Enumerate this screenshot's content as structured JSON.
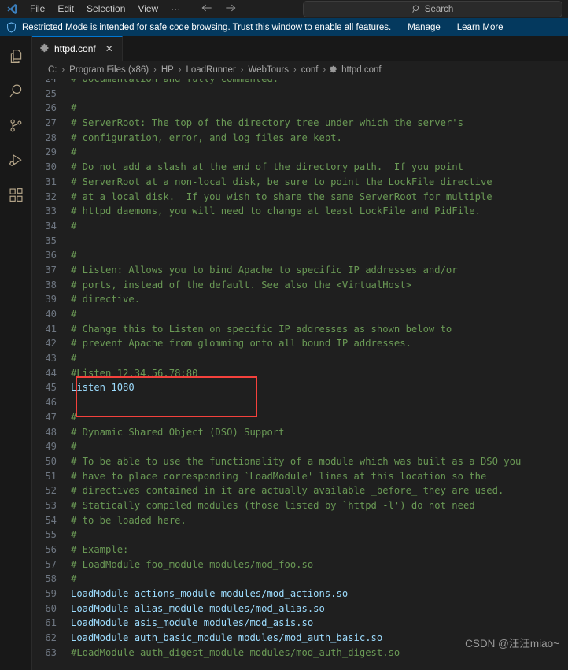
{
  "titlebar": {
    "logo_icon": "vscode-logo-icon",
    "menus": [
      {
        "label": "File"
      },
      {
        "label": "Edit"
      },
      {
        "label": "Selection"
      },
      {
        "label": "View"
      },
      {
        "label": "···"
      }
    ],
    "back_icon": "arrow-left-icon",
    "forward_icon": "arrow-right-icon",
    "search": {
      "icon": "search-icon",
      "placeholder": "Search",
      "value": "Search"
    }
  },
  "banner": {
    "icon": "shield-icon",
    "text": "Restricted Mode is intended for safe code browsing. Trust this window to enable all features.",
    "manage_label": "Manage",
    "learn_more_label": "Learn More",
    "background": "#04395e"
  },
  "activitybar": {
    "items": [
      {
        "name": "explorer",
        "icon": "files-icon",
        "active": true
      },
      {
        "name": "search",
        "icon": "search-icon",
        "active": false
      },
      {
        "name": "source-control",
        "icon": "source-control-icon",
        "active": false
      },
      {
        "name": "run-and-debug",
        "icon": "run-debug-icon",
        "active": false
      },
      {
        "name": "extensions",
        "icon": "extensions-icon",
        "active": false
      }
    ]
  },
  "tabs": [
    {
      "icon": "gear-icon",
      "label": "httpd.conf",
      "close_icon": "close-icon",
      "active": true
    }
  ],
  "breadcrumbs": {
    "separator": "›",
    "file_icon": "gear-icon",
    "items": [
      "C:",
      "Program Files (x86)",
      "HP",
      "LoadRunner",
      "WebTours",
      "conf",
      "httpd.conf"
    ]
  },
  "annotation": {
    "box_color": "#f4413c",
    "highlighted_lines": [
      "44",
      "45"
    ]
  },
  "watermark": {
    "text": "CSDN @汪汪miao~"
  },
  "editor": {
    "language": "apacheconf",
    "first_visible_line": 24,
    "colors": {
      "comment": "#6a9955",
      "directive": "#9cdcfe",
      "background": "#1f1f1f",
      "line_number": "#6e7681"
    },
    "lines": [
      {
        "num": "24",
        "text": "# documentation and fully commented.",
        "kind": "comment",
        "clipped": true
      },
      {
        "num": "25",
        "text": "",
        "kind": "plain"
      },
      {
        "num": "26",
        "text": "#",
        "kind": "comment"
      },
      {
        "num": "27",
        "text": "# ServerRoot: The top of the directory tree under which the server's",
        "kind": "comment"
      },
      {
        "num": "28",
        "text": "# configuration, error, and log files are kept.",
        "kind": "comment"
      },
      {
        "num": "29",
        "text": "#",
        "kind": "comment"
      },
      {
        "num": "30",
        "text": "# Do not add a slash at the end of the directory path.  If you point",
        "kind": "comment"
      },
      {
        "num": "31",
        "text": "# ServerRoot at a non-local disk, be sure to point the LockFile directive",
        "kind": "comment"
      },
      {
        "num": "32",
        "text": "# at a local disk.  If you wish to share the same ServerRoot for multiple",
        "kind": "comment"
      },
      {
        "num": "33",
        "text": "# httpd daemons, you will need to change at least LockFile and PidFile.",
        "kind": "comment"
      },
      {
        "num": "34",
        "text": "#",
        "kind": "comment"
      },
      {
        "num": "35",
        "text": "",
        "kind": "plain"
      },
      {
        "num": "36",
        "text": "#",
        "kind": "comment"
      },
      {
        "num": "37",
        "text": "# Listen: Allows you to bind Apache to specific IP addresses and/or",
        "kind": "comment"
      },
      {
        "num": "38",
        "text": "# ports, instead of the default. See also the <VirtualHost>",
        "kind": "comment"
      },
      {
        "num": "39",
        "text": "# directive.",
        "kind": "comment"
      },
      {
        "num": "40",
        "text": "#",
        "kind": "comment"
      },
      {
        "num": "41",
        "text": "# Change this to Listen on specific IP addresses as shown below to",
        "kind": "comment"
      },
      {
        "num": "42",
        "text": "# prevent Apache from glomming onto all bound IP addresses.",
        "kind": "comment"
      },
      {
        "num": "43",
        "text": "#",
        "kind": "comment"
      },
      {
        "num": "44",
        "text": "#Listen 12.34.56.78:80",
        "kind": "comment"
      },
      {
        "num": "45",
        "text": "Listen 1080",
        "kind": "code"
      },
      {
        "num": "46",
        "text": "",
        "kind": "plain"
      },
      {
        "num": "47",
        "text": "#",
        "kind": "comment"
      },
      {
        "num": "48",
        "text": "# Dynamic Shared Object (DSO) Support",
        "kind": "comment"
      },
      {
        "num": "49",
        "text": "#",
        "kind": "comment"
      },
      {
        "num": "50",
        "text": "# To be able to use the functionality of a module which was built as a DSO you",
        "kind": "comment"
      },
      {
        "num": "51",
        "text": "# have to place corresponding `LoadModule' lines at this location so the",
        "kind": "comment"
      },
      {
        "num": "52",
        "text": "# directives contained in it are actually available _before_ they are used.",
        "kind": "comment"
      },
      {
        "num": "53",
        "text": "# Statically compiled modules (those listed by `httpd -l') do not need",
        "kind": "comment"
      },
      {
        "num": "54",
        "text": "# to be loaded here.",
        "kind": "comment"
      },
      {
        "num": "55",
        "text": "#",
        "kind": "comment"
      },
      {
        "num": "56",
        "text": "# Example:",
        "kind": "comment"
      },
      {
        "num": "57",
        "text": "# LoadModule foo_module modules/mod_foo.so",
        "kind": "comment"
      },
      {
        "num": "58",
        "text": "#",
        "kind": "comment"
      },
      {
        "num": "59",
        "text": "LoadModule actions_module modules/mod_actions.so",
        "kind": "code"
      },
      {
        "num": "60",
        "text": "LoadModule alias_module modules/mod_alias.so",
        "kind": "code"
      },
      {
        "num": "61",
        "text": "LoadModule asis_module modules/mod_asis.so",
        "kind": "code"
      },
      {
        "num": "62",
        "text": "LoadModule auth_basic_module modules/mod_auth_basic.so",
        "kind": "code"
      },
      {
        "num": "63",
        "text": "#LoadModule auth_digest_module modules/mod_auth_digest.so",
        "kind": "comment"
      }
    ]
  }
}
